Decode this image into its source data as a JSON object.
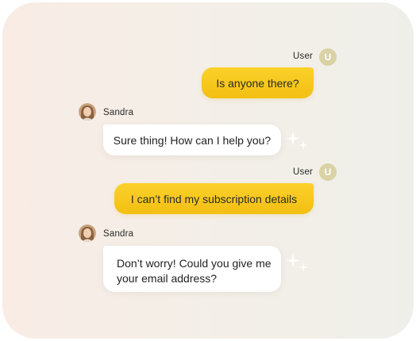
{
  "messages": [
    {
      "sender": "User",
      "avatar_initial": "U",
      "text": "Is anyone there?"
    },
    {
      "sender": "Sandra",
      "avatar": "woman-avatar",
      "text": "Sure thing! How can I help you?"
    },
    {
      "sender": "User",
      "avatar_initial": "U",
      "text": "I can’t find my subscription details"
    },
    {
      "sender": "Sandra",
      "avatar": "woman-avatar",
      "text_line1": "Don’t worry! Could you give me",
      "text_line2": "your email address?"
    }
  ],
  "colors": {
    "user_bubble": "#fbd12a",
    "user_avatar": "#d9d2a5",
    "agent_bubble": "#ffffff"
  }
}
